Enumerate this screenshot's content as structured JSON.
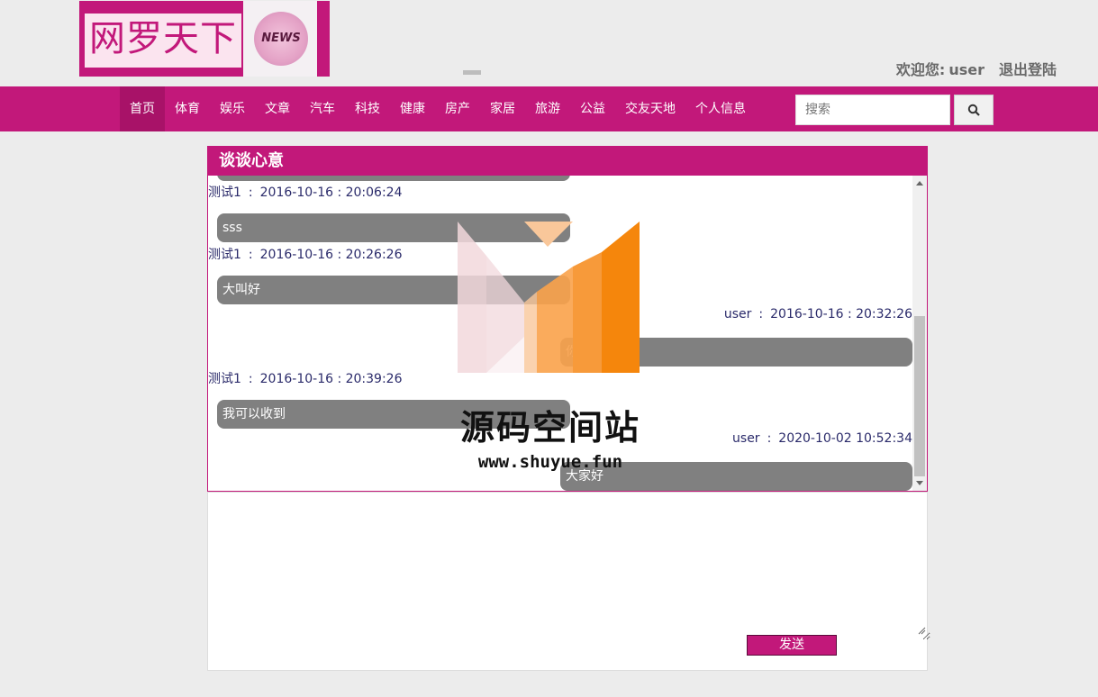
{
  "header": {
    "logo_text": "网罗天下",
    "logo_badge": "NEWS",
    "welcome_label": "欢迎您:",
    "username": "user",
    "logout_label": "退出登陆"
  },
  "nav": {
    "items": [
      {
        "label": "首页",
        "active": true
      },
      {
        "label": "体育"
      },
      {
        "label": "娱乐"
      },
      {
        "label": "文章"
      },
      {
        "label": "汽车"
      },
      {
        "label": "科技"
      },
      {
        "label": "健康"
      },
      {
        "label": "房产"
      },
      {
        "label": "家居"
      },
      {
        "label": "旅游"
      },
      {
        "label": "公益"
      },
      {
        "label": "交友天地"
      },
      {
        "label": "个人信息"
      }
    ],
    "search_placeholder": "搜索"
  },
  "chat": {
    "title": "谈谈心意",
    "messages": [
      {
        "user": "测试1",
        "sep": ":",
        "time": "2016-10-16 : 20:06:24",
        "text": "sss",
        "side": "left"
      },
      {
        "user": "测试1",
        "sep": ":",
        "time": "2016-10-16 : 20:26:26",
        "text": "大叫好",
        "side": "left"
      },
      {
        "user": "user",
        "sep": ":",
        "time": "2016-10-16 : 20:32:26",
        "text": "你",
        "side": "right"
      },
      {
        "user": "测试1",
        "sep": ":",
        "time": "2016-10-16 : 20:39:26",
        "text": "我可以收到",
        "side": "left"
      },
      {
        "user": "user",
        "sep": ":",
        "time": "2020-10-02 10:52:34",
        "text": "大家好",
        "side": "right"
      }
    ]
  },
  "compose": {
    "send_label": "发送"
  },
  "watermark": {
    "title": "源码空间站",
    "url": "www.shuyue.fun"
  },
  "colors": {
    "brand": "#c2187a",
    "bubble": "#808080"
  }
}
